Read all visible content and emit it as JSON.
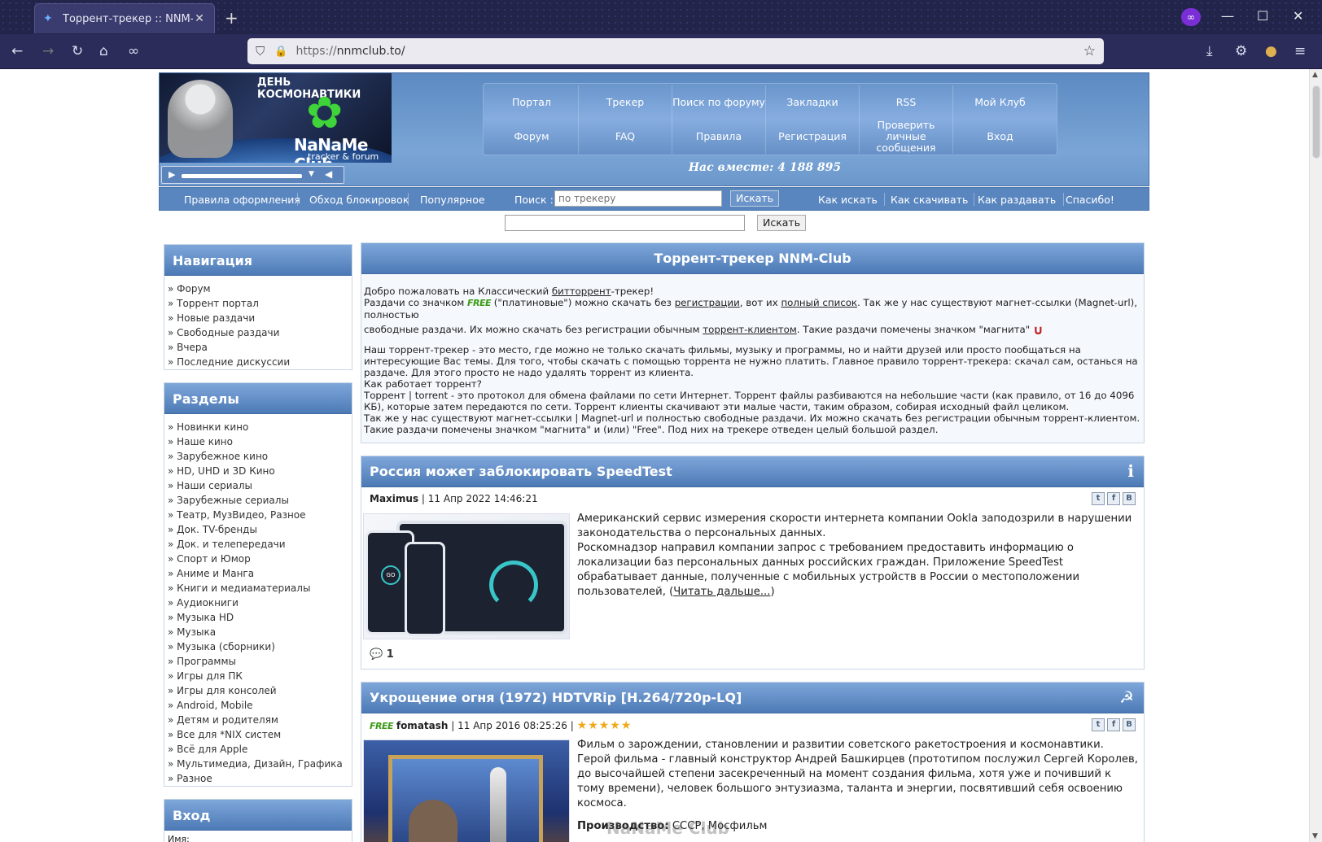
{
  "browser": {
    "tab_title": "Торрент-трекер :: NNM-Club",
    "url_proto": "https://",
    "url_host": "nnmclub.to/",
    "icons": [
      "back-icon",
      "forward-icon",
      "reload-icon",
      "home-icon",
      "private-icon",
      "shield-icon",
      "lock-icon",
      "star-icon",
      "download-icon",
      "extensions-icon",
      "account-icon",
      "menu-icon"
    ]
  },
  "header": {
    "banner_title": "ДЕНЬ КОСМОНАВТИКИ",
    "logo": "NaNaMe Club",
    "logo_sub": "tracker & forum",
    "menu": [
      "Портал",
      "Трекер",
      "Поиск по форуму",
      "Закладки",
      "RSS",
      "Мой Клуб",
      "Форум",
      "FAQ",
      "Правила",
      "Регистрация",
      "Проверить личные сообщения",
      "Вход"
    ],
    "together": "Нас вместе: 4 188 895"
  },
  "subnav": {
    "links_left": [
      "Правила оформления",
      "Обход блокировок",
      "Популярное"
    ],
    "search_label": "Поиск :",
    "search_placeholder": "по трекеру",
    "search_button": "Искать",
    "links_right": [
      "Как искать",
      "Как скачивать",
      "Как раздавать",
      "Спасибо!"
    ]
  },
  "top_search": {
    "button": "Искать"
  },
  "nav_panel": {
    "title": "Навигация",
    "items": [
      "Форум",
      "Торрент портал",
      "Новые раздачи",
      "Свободные раздачи",
      "Вчера",
      "Последние дискуссии"
    ]
  },
  "sections_panel": {
    "title": "Разделы",
    "items": [
      "Новинки кино",
      "Наше кино",
      "Зарубежное кино",
      "HD, UHD и 3D Кино",
      "Наши сериалы",
      "Зарубежные сериалы",
      "Театр, МузВидео, Разное",
      "Док. TV-бренды",
      "Док. и телепередачи",
      "Спорт и Юмор",
      "Аниме и Манга",
      "Книги и медиаматериалы",
      "Аудиокниги",
      "Музыка HD",
      "Музыка",
      "Музыка (сборники)",
      "Программы",
      "Игры для ПК",
      "Игры для консолей",
      "Android, Mobile",
      "Детям и родителям",
      "Все для *NIX систем",
      "Всё для Apple",
      "Мультимедиа, Дизайн, Графика",
      "Разное"
    ]
  },
  "login_panel": {
    "title": "Вход",
    "login_label": "Имя:"
  },
  "intro": {
    "title": "Торрент-трекер NNM-Club",
    "l1a": "Добро пожаловать на Классический ",
    "l1b": "битторрент",
    "l1c": "-трекер!",
    "l2a": "Раздачи со значком ",
    "free": "FREE",
    "l2b": " (\"платиновые\") можно скачать без ",
    "l2c": "регистрации",
    "l2d": ", вот их ",
    "l2e": "полный список",
    "l2f": ". Так же у нас существуют магнет-ссылки (Magnet-url), полностью",
    "l3a": "свободные раздачи. Их можно скачать без регистрации обычным ",
    "l3b": "торрент-клиентом",
    "l3c": ". Такие раздачи помечены значком \"магнита\"",
    "p2": "Наш торрент-трекер - это место, где можно не только скачать фильмы, музыку и программы, но и найти друзей или просто пообщаться на интересующие Вас темы. Для того, чтобы скачать с помощью торрента не нужно платить. Главное правило торрент-трекера: скачал сам, останься на раздаче. Для этого просто не надо удалять торрент из клиента.",
    "p3": "Как работает торрент?",
    "p4": "Торрент | torrent - это протокол для обмена файлами по сети Интернет. Торрент файлы разбиваются на небольшие части (как правило, от 16 до 4096 КБ), которые затем передаются по сети. Торрент клиенты скачивают эти малые части, таким образом, собирая исходный файл целиком.",
    "p5": "Так же у нас существуют магнет-ссылки | Magnet-url и полностью свободные раздачи. Их можно скачать без регистрации обычным торрент-клиентом. Такие раздачи помечены значком \"магнита\" и (или) \"Free\". Под них на трекере отведен целый большой раздел."
  },
  "news": [
    {
      "title": "Россия может заблокировать SpeedTest",
      "author": "Maximus",
      "date": "| 11 Апр 2022 14:46:21",
      "text": "Американский сервис измерения скорости интернета компании Ookla заподозрили в нарушении законодательства о персональных данных.",
      "text2": "Роскомнадзор направил компании запрос с требованием предоставить информацию о локализации баз персональных данных российских граждан. Приложение SpeedTest обрабатывает данные, полученные с мобильных устройств в России о местоположении пользователей, (",
      "more": "Читать дальше...",
      "more_close": ")",
      "comments": "1"
    },
    {
      "title": "Укрощение огня (1972) HDTVRip [H.264/720p-LQ]",
      "free": "FREE",
      "author": "fomatash",
      "date": "| 11 Апр 2016 08:25:26 |",
      "rating": 5,
      "text": "Фильм о зарождении, становлении и развитии советского ракетостроения и космонавтики. Герой фильма - главный конструктор Андрей Башкирцев (прототипом послужил Сергей Королев, до высочайшей степени засекреченный на момент создания фильма, хотя уже и почивший к тому времени), человек большого энтузиазма, таланта и энергии, посвятивший себя освоению космоса.",
      "prod_label": "Производство:",
      "prod_value": "СССР, Мосфильм"
    }
  ],
  "watermark": "NaNaMe Club"
}
